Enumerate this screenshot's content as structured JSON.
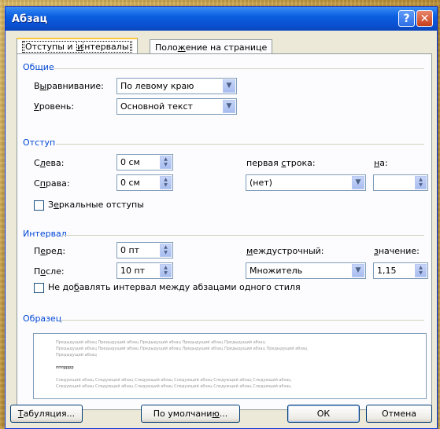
{
  "window": {
    "title": "Абзац",
    "help_label": "?",
    "close_label": "✕"
  },
  "tabs": [
    {
      "pre": "Отступы и ",
      "u": "и",
      "post": "нтервалы"
    },
    {
      "pre": "Поло",
      "u": "ж",
      "post": "ение на странице"
    }
  ],
  "general": {
    "title": "Общие",
    "alignment_label": {
      "pre": "В",
      "u": "ы",
      "post": "равнивание:"
    },
    "alignment_value": "По левому краю",
    "level_label": {
      "pre": "",
      "u": "У",
      "post": "ровень:"
    },
    "level_value": "Основной текст"
  },
  "indent": {
    "title": "Отступ",
    "left_label": {
      "pre": "С",
      "u": "л",
      "post": "ева:"
    },
    "left_value": "0 см",
    "right_label": {
      "pre": "С",
      "u": "п",
      "post": "рава:"
    },
    "right_value": "0 см",
    "first_line_label": {
      "pre": "первая ",
      "u": "с",
      "post": "трока:"
    },
    "first_line_value": "(нет)",
    "by_label": {
      "pre": "",
      "u": "н",
      "post": "а:"
    },
    "by_value": "",
    "mirror_label": {
      "pre": "З",
      "u": "е",
      "post": "ркальные отступы"
    },
    "mirror_checked": false
  },
  "spacing": {
    "title": "Интервал",
    "before_label": {
      "pre": "П",
      "u": "е",
      "post": "ред:"
    },
    "before_value": "0 пт",
    "after_label": {
      "pre": "П",
      "u": "о",
      "post": "сле:"
    },
    "after_value": "10 пт",
    "line_label": {
      "pre": "",
      "u": "м",
      "post": "еждустрочный:"
    },
    "line_value": "Множитель",
    "value_label": {
      "pre": "",
      "u": "з",
      "post": "начение:"
    },
    "value_value": "1,15",
    "no_space_label": {
      "pre": "Не до",
      "u": "б",
      "post": "авлять интервал между абзацами одного стиля"
    },
    "no_space_checked": false
  },
  "preview": {
    "title": "Образец",
    "prev_lines": [
      "Предыдущий абзац Предыдущий абзац Предыдущий абзац Предыдущий абзац Предыдущий абзац",
      "Предыдущий абзац Предыдущий абзац Предыдущий абзац Предыдущий абзац Предыдущий абзац Предыдущий абзац",
      "Предыдущий абзац"
    ],
    "sample": "пппрррр",
    "next_lines": [
      "Следующий абзац Следующий абзац Следующий абзац Следующий абзац Следующий абзац Следующий абзац",
      "Следующий абзац Следующий абзац Следующий абзац Следующий абзац Следующий абзац Следующий абзац"
    ]
  },
  "buttons": {
    "tabs": {
      "pre": "",
      "u": "Т",
      "post": "абуляция..."
    },
    "default": {
      "pre": "По умолчани",
      "u": "ю",
      "post": "..."
    },
    "ok": "ОК",
    "cancel": "Отмена"
  }
}
